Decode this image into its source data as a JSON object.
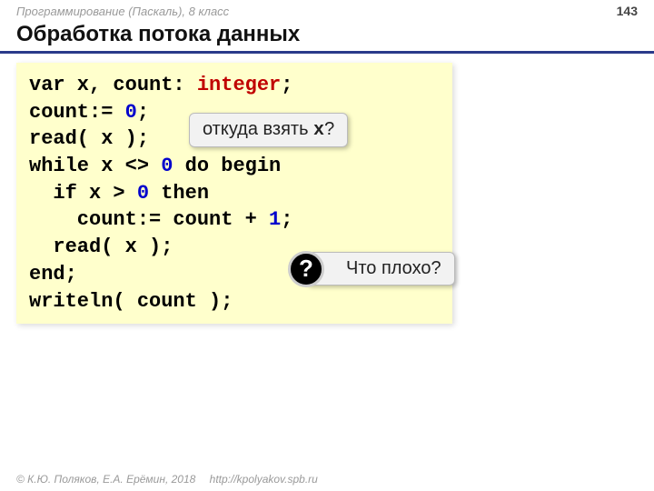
{
  "header": {
    "course": "Программирование (Паскаль), 8 класс",
    "page": "143"
  },
  "title": "Обработка потока данных",
  "code": {
    "l1a": "var x",
    "l1b": ", count: ",
    "l1c": "integer",
    "l1d": ";",
    "l2a": "count:",
    "l2b": "= ",
    "l2c": "0",
    "l2d": ";",
    "l3": "read( x );",
    "l4a": "while x ",
    "l4b": "<>",
    "l4c": " ",
    "l4d": "0",
    "l4e": " do begin",
    "l5a": "  if x ",
    "l5b": ">",
    "l5c": " ",
    "l5d": "0",
    "l5e": " then",
    "l6a": "    count:= count + ",
    "l6b": "1",
    "l6c": ";",
    "l7": "  read( x );",
    "l8": "end;",
    "l9": "writeln( count );"
  },
  "callouts": {
    "c1a": "откуда взять ",
    "c1b": "x",
    "c1c": "?",
    "c2": "Что плохо?",
    "qmark": "?"
  },
  "footer": {
    "copyright": "© К.Ю. Поляков, Е.А. Ерёмин, 2018",
    "url": "http://kpolyakov.spb.ru"
  }
}
